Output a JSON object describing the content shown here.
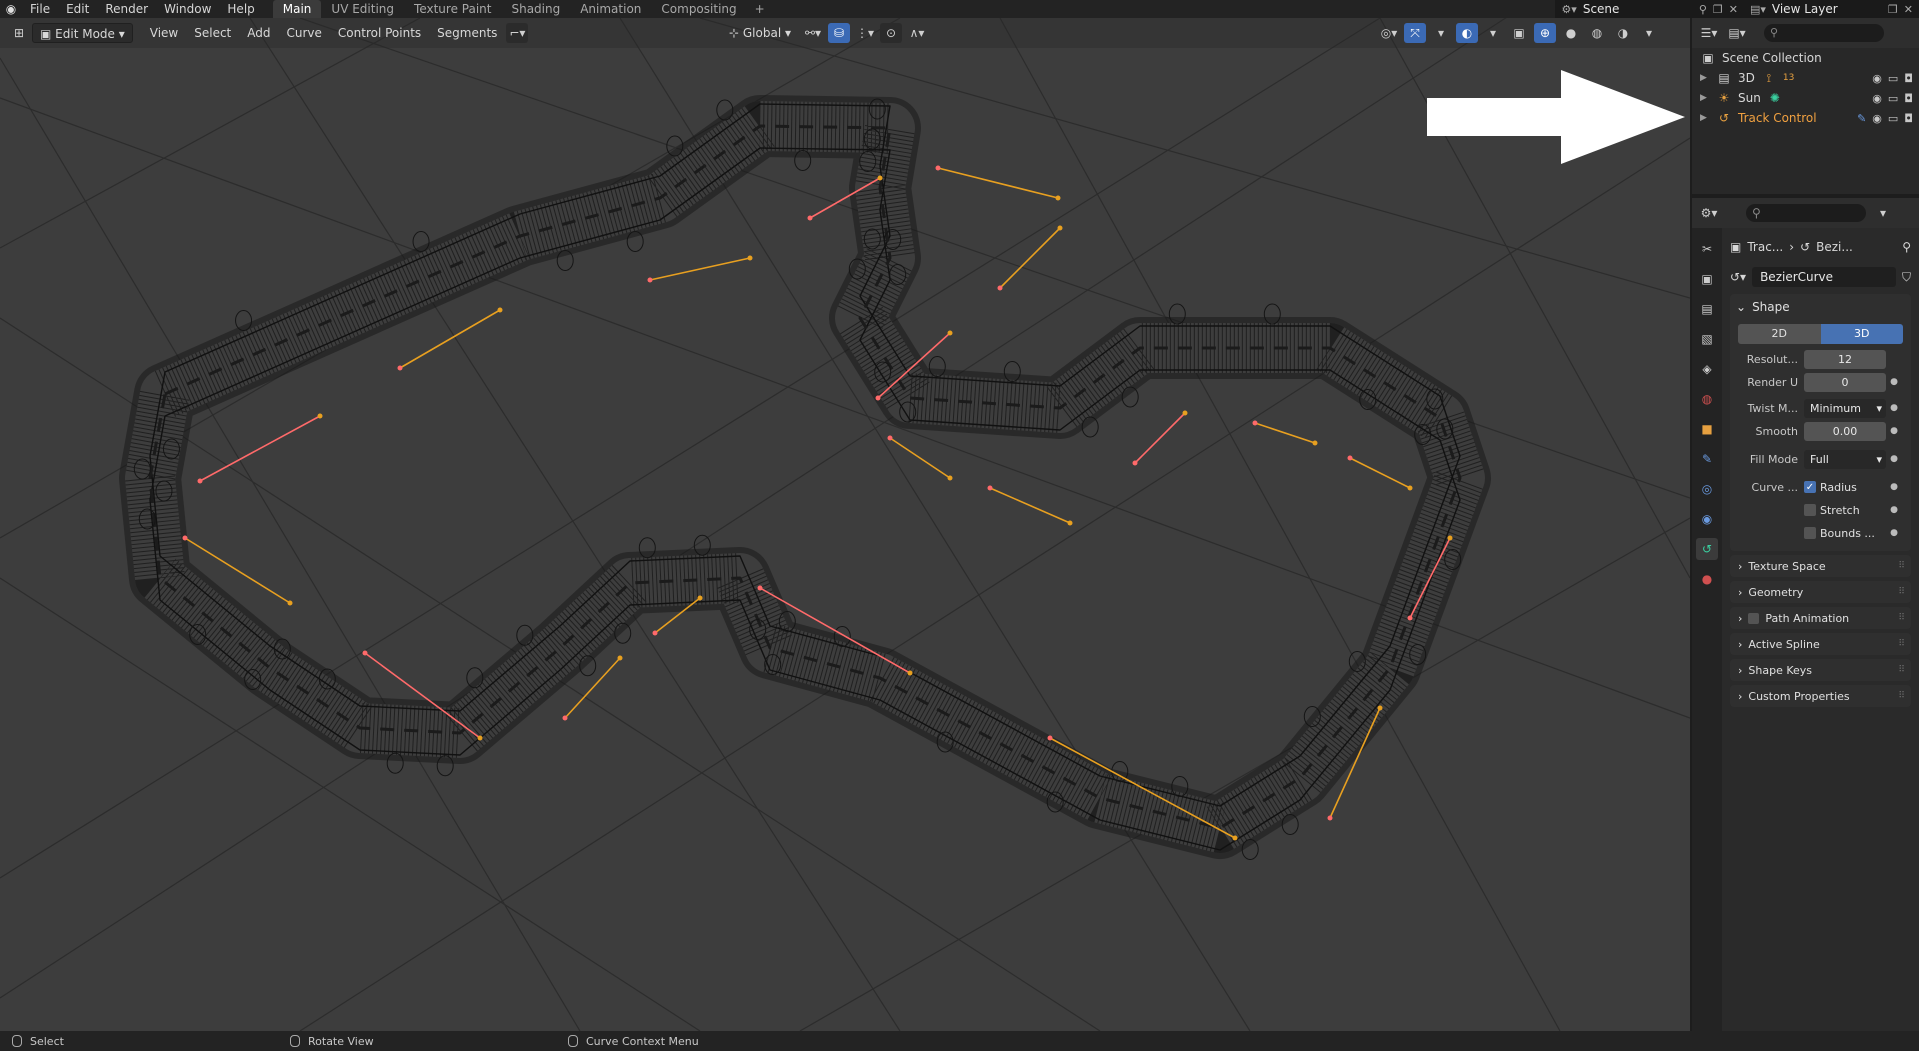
{
  "topbar": {
    "menus": [
      "File",
      "Edit",
      "Render",
      "Window",
      "Help"
    ],
    "workspaces": [
      "Main",
      "UV Editing",
      "Texture Paint",
      "Shading",
      "Animation",
      "Compositing"
    ],
    "active_workspace": "Main",
    "add_tab": "+",
    "scene": "Scene",
    "view_layer": "View Layer"
  },
  "viewport": {
    "mode": "Edit Mode",
    "menus": [
      "View",
      "Select",
      "Add",
      "Curve",
      "Control Points",
      "Segments"
    ],
    "transform_orientation": "Global"
  },
  "outliner": {
    "root": "Scene Collection",
    "items": [
      {
        "label": "3D",
        "badge": "13",
        "active": false
      },
      {
        "label": "Sun",
        "active": false
      },
      {
        "label": "Track Control",
        "active": true
      }
    ]
  },
  "properties": {
    "breadcrumb": [
      "Trac...",
      "Bezi..."
    ],
    "datablock": "BezierCurve",
    "shape_panel": {
      "title": "Shape",
      "dimensions": [
        "2D",
        "3D"
      ],
      "active_dimension": "3D",
      "resolution_label": "Resolut...",
      "resolution_value": "12",
      "render_u_label": "Render U",
      "render_u_value": "0",
      "twist_label": "Twist M...",
      "twist_value": "Minimum",
      "smooth_label": "Smooth",
      "smooth_value": "0.00",
      "fill_label": "Fill Mode",
      "fill_value": "Full",
      "curve_label": "Curve ...",
      "radius_label": "Radius",
      "stretch_label": "Stretch",
      "bounds_label": "Bounds ..."
    },
    "subpanels": [
      "Texture Space",
      "Geometry",
      "Path Animation",
      "Active Spline",
      "Shape Keys",
      "Custom Properties"
    ]
  },
  "statusbar": {
    "select": "Select",
    "rotate": "Rotate View",
    "context": "Curve Context Menu"
  },
  "colors": {
    "accent": "#4772b3",
    "active_object": "#f0a040",
    "handle_orange": "#e8a020",
    "handle_pink": "#ff6a6a",
    "wire": "#111111"
  }
}
